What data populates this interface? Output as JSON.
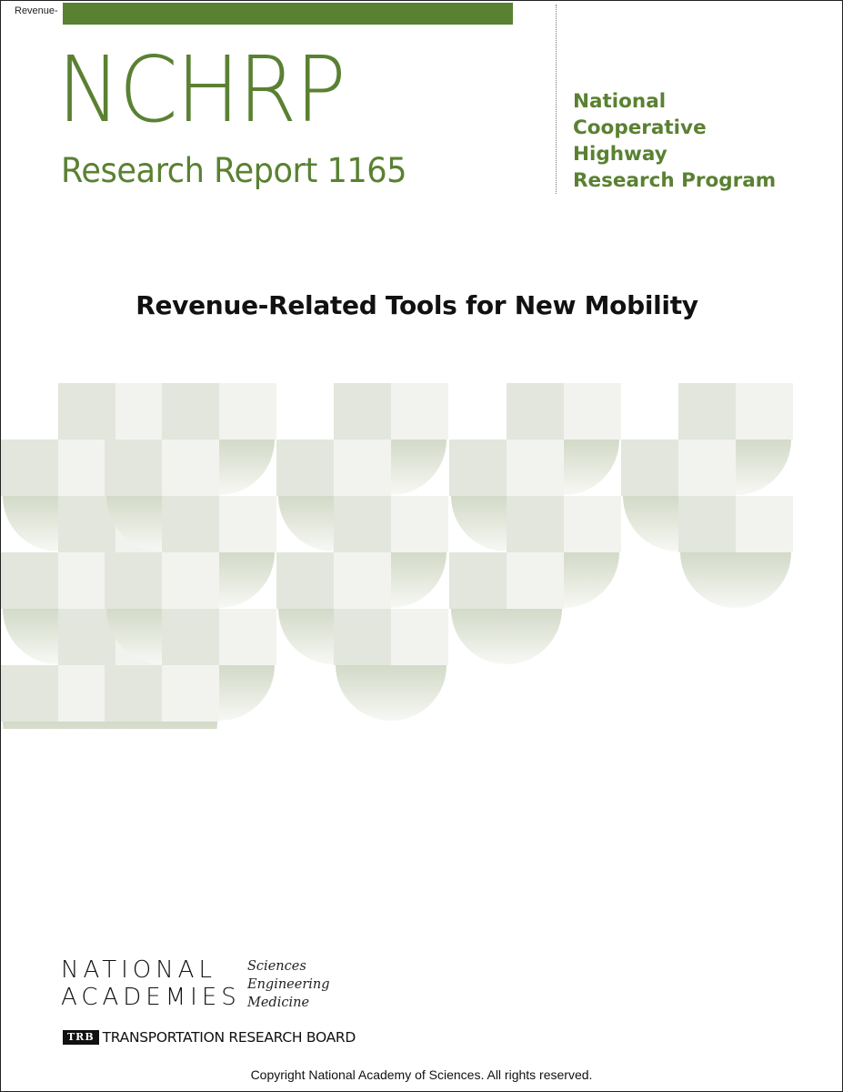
{
  "header": {
    "tab_label": "Revenue-",
    "series_name": "NCHRP",
    "report_line": "Research Report 1165",
    "program_lines": [
      "National",
      "Cooperative",
      "Highway",
      "Research Program"
    ]
  },
  "title": "Revenue-Related Tools for New Mobility",
  "footer": {
    "na_lines": [
      "NATIONAL",
      "ACADEMIES"
    ],
    "na_sub": [
      "Sciences",
      "Engineering",
      "Medicine"
    ],
    "trb_mark": "TRB",
    "trb_text": "TRANSPORTATION RESEARCH BOARD",
    "copyright": "Copyright National Academy of Sciences. All rights reserved."
  },
  "colors": {
    "brand_green": "#5a8132",
    "pattern_light": "#f2f3ef",
    "pattern_dark": "#e2e6dc"
  }
}
